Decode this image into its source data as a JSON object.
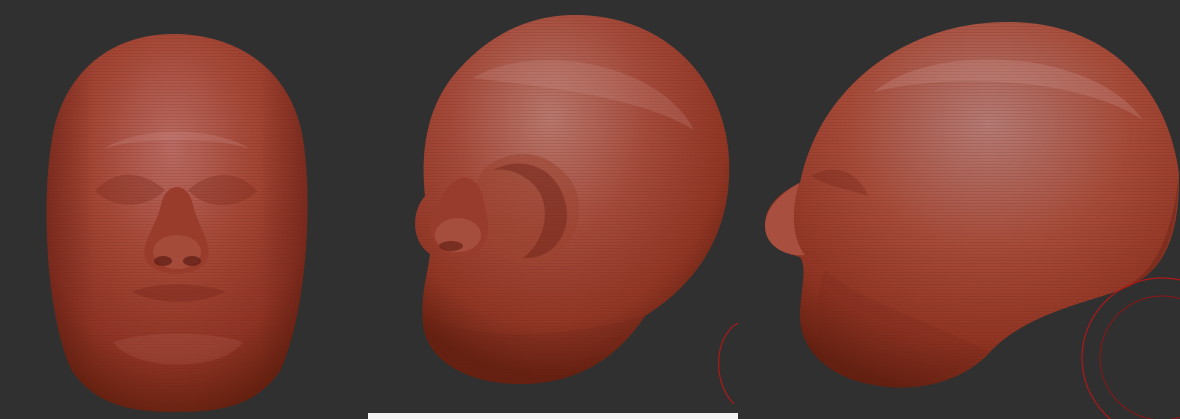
{
  "viewport": {
    "background_color": "#303030",
    "material_color": "#a2412f",
    "material_highlight": "#c77a72",
    "material_shadow": "#5e1d14",
    "cursor_color": "#b01818",
    "views": [
      "front",
      "three-quarter",
      "side"
    ]
  },
  "icons": {
    "brush_cursor": "brush-cursor-icon",
    "brush_ring": "brush-ring-icon"
  }
}
